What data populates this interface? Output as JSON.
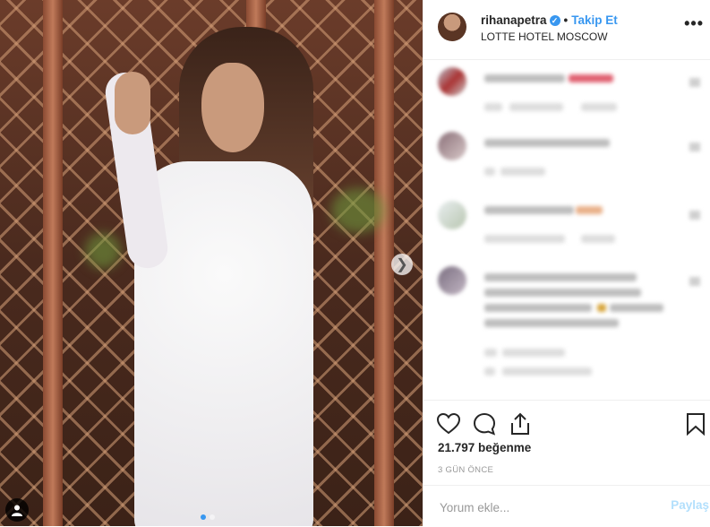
{
  "post": {
    "username": "rihanapetra",
    "follow_label": "Takip Et",
    "separator": "•",
    "location": "LOTTE HOTEL MOSCOW",
    "more_label": "•••",
    "likes": "21.797 beğenme",
    "date": "3 GÜN ÖNCE",
    "comment_placeholder": "Yorum ekle...",
    "share_label": "Paylaş",
    "carousel": {
      "slides": 2,
      "active": 0
    }
  },
  "icons": {
    "verified": "verified-badge-icon",
    "next": "chevron-right-icon",
    "like": "heart-icon",
    "comment": "comment-bubble-icon",
    "share": "share-upload-icon",
    "save": "bookmark-icon",
    "user_tag": "user-tag-icon"
  },
  "colors": {
    "accent": "#3897f0",
    "share_disabled": "#b2dffc"
  }
}
